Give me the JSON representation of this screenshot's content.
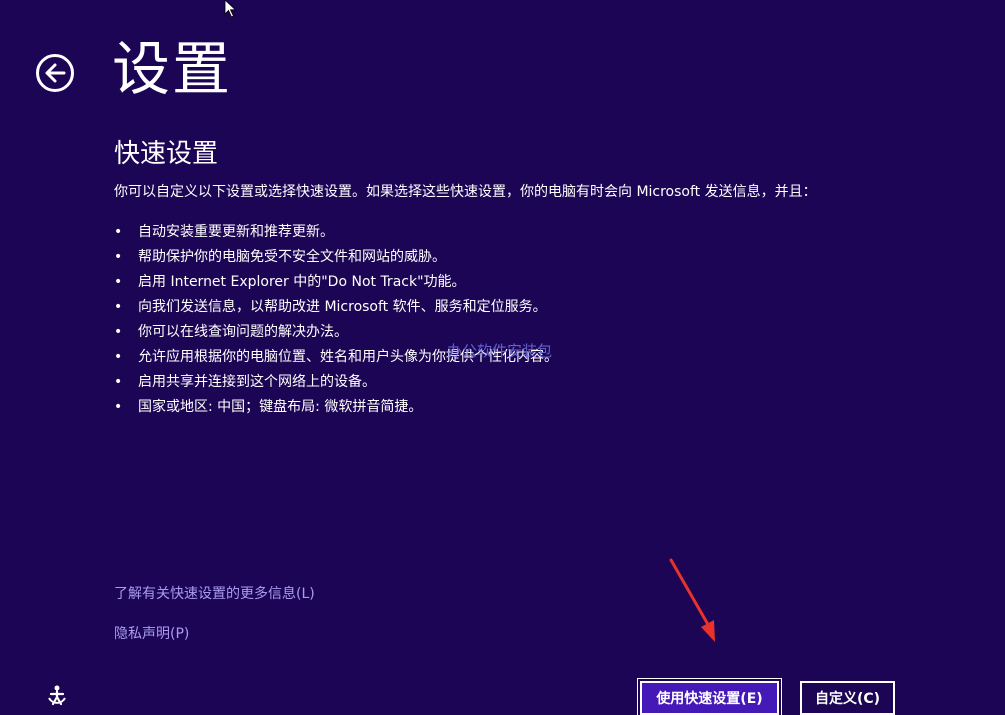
{
  "header": {
    "title": "设置"
  },
  "section": {
    "title": "快速设置",
    "intro": "你可以自定义以下设置或选择快速设置。如果选择这些快速设置，你的电脑有时会向 Microsoft 发送信息，并且："
  },
  "features": [
    "自动安装重要更新和推荐更新。",
    "帮助保护你的电脑免受不安全文件和网站的威胁。",
    "启用 Internet Explorer 中的\"Do Not Track\"功能。",
    "向我们发送信息，以帮助改进 Microsoft 软件、服务和定位服务。",
    "你可以在线查询问题的解决办法。",
    "允许应用根据你的电脑位置、姓名和用户头像为你提供个性化内容。",
    "启用共享并连接到这个网络上的设备。",
    "国家或地区: 中国；键盘布局: 微软拼音简捷。"
  ],
  "watermark": "办公软件安装包",
  "links": {
    "more_info": "了解有关快速设置的更多信息(L)",
    "privacy": "隐私声明(P)"
  },
  "buttons": {
    "express": "使用快速设置(E)",
    "customize": "自定义(C)"
  },
  "icons": {
    "back": "back-arrow-icon",
    "ease_of_access": "ease-of-access-icon",
    "cursor": "mouse-cursor-icon"
  },
  "colors": {
    "background": "#1d0556",
    "primary_button": "#4419b8",
    "link": "#a89cf0",
    "annotation_arrow": "#e8322b"
  }
}
